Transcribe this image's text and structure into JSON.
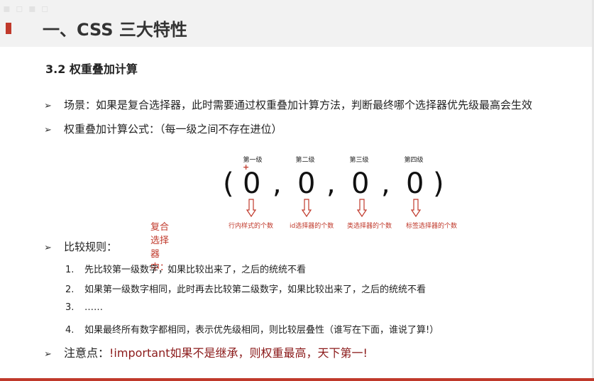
{
  "slide": {
    "title": "一、CSS 三大特性",
    "section": "3.2 权重叠加计算"
  },
  "bullets": [
    {
      "arrow": "➢",
      "text": "场景：如果是复合选择器，此时需要通过权重叠加计算方法，判断最终哪个选择器优先级最高会生效"
    },
    {
      "arrow": "➢",
      "text": "权重叠加计算公式：（每一级之间不存在进位）"
    }
  ],
  "formula": {
    "open": "(",
    "close": ")",
    "separator": ",",
    "levels": [
      {
        "label": "第一级",
        "value": "0",
        "count_label": "行内样式的个数"
      },
      {
        "label": "第二级",
        "value": "0",
        "count_label": "id选择器的个数"
      },
      {
        "label": "第三级",
        "value": "0",
        "count_label": "类选择器的个数"
      },
      {
        "label": "第四级",
        "value": "0",
        "count_label": "标签选择器的个数"
      }
    ],
    "plus_mark": "+",
    "composite_label": "复合选择器中："
  },
  "compare": {
    "arrow": "➢",
    "title": "比较规则：",
    "rules": [
      {
        "num": "1.",
        "text": "先比较第一级数字，如果比较出来了，之后的统统不看"
      },
      {
        "num": "2.",
        "text": "如果第一级数字相同，此时再去比较第二级数字，如果比较出来了，之后的统统不看"
      },
      {
        "num": "3.",
        "text": "……"
      },
      {
        "num": "4.",
        "text": "如果最终所有数字都相同，表示优先级相同，则比较层叠性（谁写在下面，谁说了算!）"
      }
    ]
  },
  "note": {
    "arrow": "➢",
    "label": "注意点：",
    "text": "!important如果不是继承，则权重最高，天下第一!"
  },
  "colors": {
    "accent_red": "#c0392b",
    "note_red": "#8b1a1a",
    "header_bg": "#f2f2f2"
  }
}
